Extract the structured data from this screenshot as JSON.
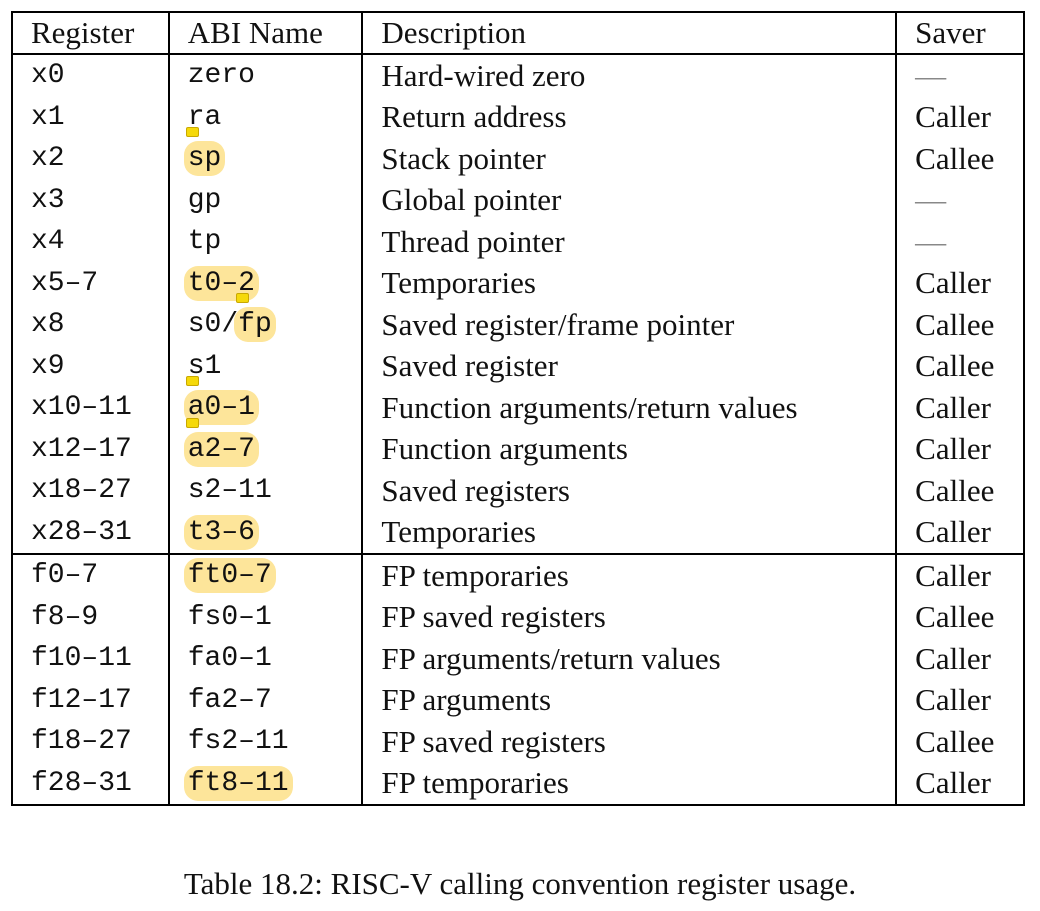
{
  "table": {
    "headers": [
      "Register",
      "ABI Name",
      "Description",
      "Saver"
    ],
    "rows": [
      {
        "register": "x0",
        "abi": "zero",
        "description": "Hard-wired zero",
        "saver": "—",
        "highlight": false
      },
      {
        "register": "x1",
        "abi": "ra",
        "description": "Return address",
        "saver": "Caller",
        "highlight": false
      },
      {
        "register": "x2",
        "abi": "sp",
        "description": "Stack pointer",
        "saver": "Callee",
        "highlight": true,
        "note": true
      },
      {
        "register": "x3",
        "abi": "gp",
        "description": "Global pointer",
        "saver": "—",
        "highlight": false
      },
      {
        "register": "x4",
        "abi": "tp",
        "description": "Thread pointer",
        "saver": "—",
        "highlight": false
      },
      {
        "register": "x5–7",
        "abi": "t0–2",
        "description": "Temporaries",
        "saver": "Caller",
        "highlight": true
      },
      {
        "register": "x8",
        "abi": "s0/fp",
        "abi_prefix": "s0/",
        "abi_highlighted": "fp",
        "description": "Saved register/frame pointer",
        "saver": "Callee",
        "highlight": "partial",
        "note": true
      },
      {
        "register": "x9",
        "abi": "s1",
        "description": "Saved register",
        "saver": "Callee",
        "highlight": false
      },
      {
        "register": "x10–11",
        "abi": "a0–1",
        "description": "Function arguments/return values",
        "saver": "Caller",
        "highlight": true,
        "note": true
      },
      {
        "register": "x12–17",
        "abi": "a2–7",
        "description": "Function arguments",
        "saver": "Caller",
        "highlight": true,
        "note": true
      },
      {
        "register": "x18–27",
        "abi": "s2–11",
        "description": "Saved registers",
        "saver": "Callee",
        "highlight": false
      },
      {
        "register": "x28–31",
        "abi": "t3–6",
        "description": "Temporaries",
        "saver": "Caller",
        "highlight": true
      },
      {
        "register": "f0–7",
        "abi": "ft0–7",
        "description": "FP temporaries",
        "saver": "Caller",
        "highlight": true,
        "separator": true
      },
      {
        "register": "f8–9",
        "abi": "fs0–1",
        "description": "FP saved registers",
        "saver": "Callee",
        "highlight": false
      },
      {
        "register": "f10–11",
        "abi": "fa0–1",
        "description": "FP arguments/return values",
        "saver": "Caller",
        "highlight": false
      },
      {
        "register": "f12–17",
        "abi": "fa2–7",
        "description": "FP arguments",
        "saver": "Caller",
        "highlight": false
      },
      {
        "register": "f18–27",
        "abi": "fs2–11",
        "description": "FP saved registers",
        "saver": "Callee",
        "highlight": false
      },
      {
        "register": "f28–31",
        "abi": "ft8–11",
        "description": "FP temporaries",
        "saver": "Caller",
        "highlight": true
      }
    ]
  },
  "caption": "Table 18.2: RISC-V calling convention register usage.",
  "colors": {
    "highlight": "#fde59a",
    "note": "#f5d90a"
  }
}
